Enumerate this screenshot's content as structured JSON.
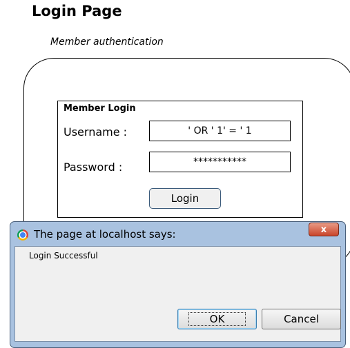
{
  "page": {
    "title": "Login Page",
    "subtitle": "Member authentication"
  },
  "login_form": {
    "heading": "Member Login",
    "username_label": "Username :",
    "username_value": "' OR ' 1' = ' 1",
    "password_label": "Password  :",
    "password_value": "***********",
    "login_button": "Login"
  },
  "dialog": {
    "title": "The page at localhost says:",
    "close_label": "x",
    "message": "Login Successful",
    "ok_button": "OK",
    "cancel_button": "Cancel"
  }
}
